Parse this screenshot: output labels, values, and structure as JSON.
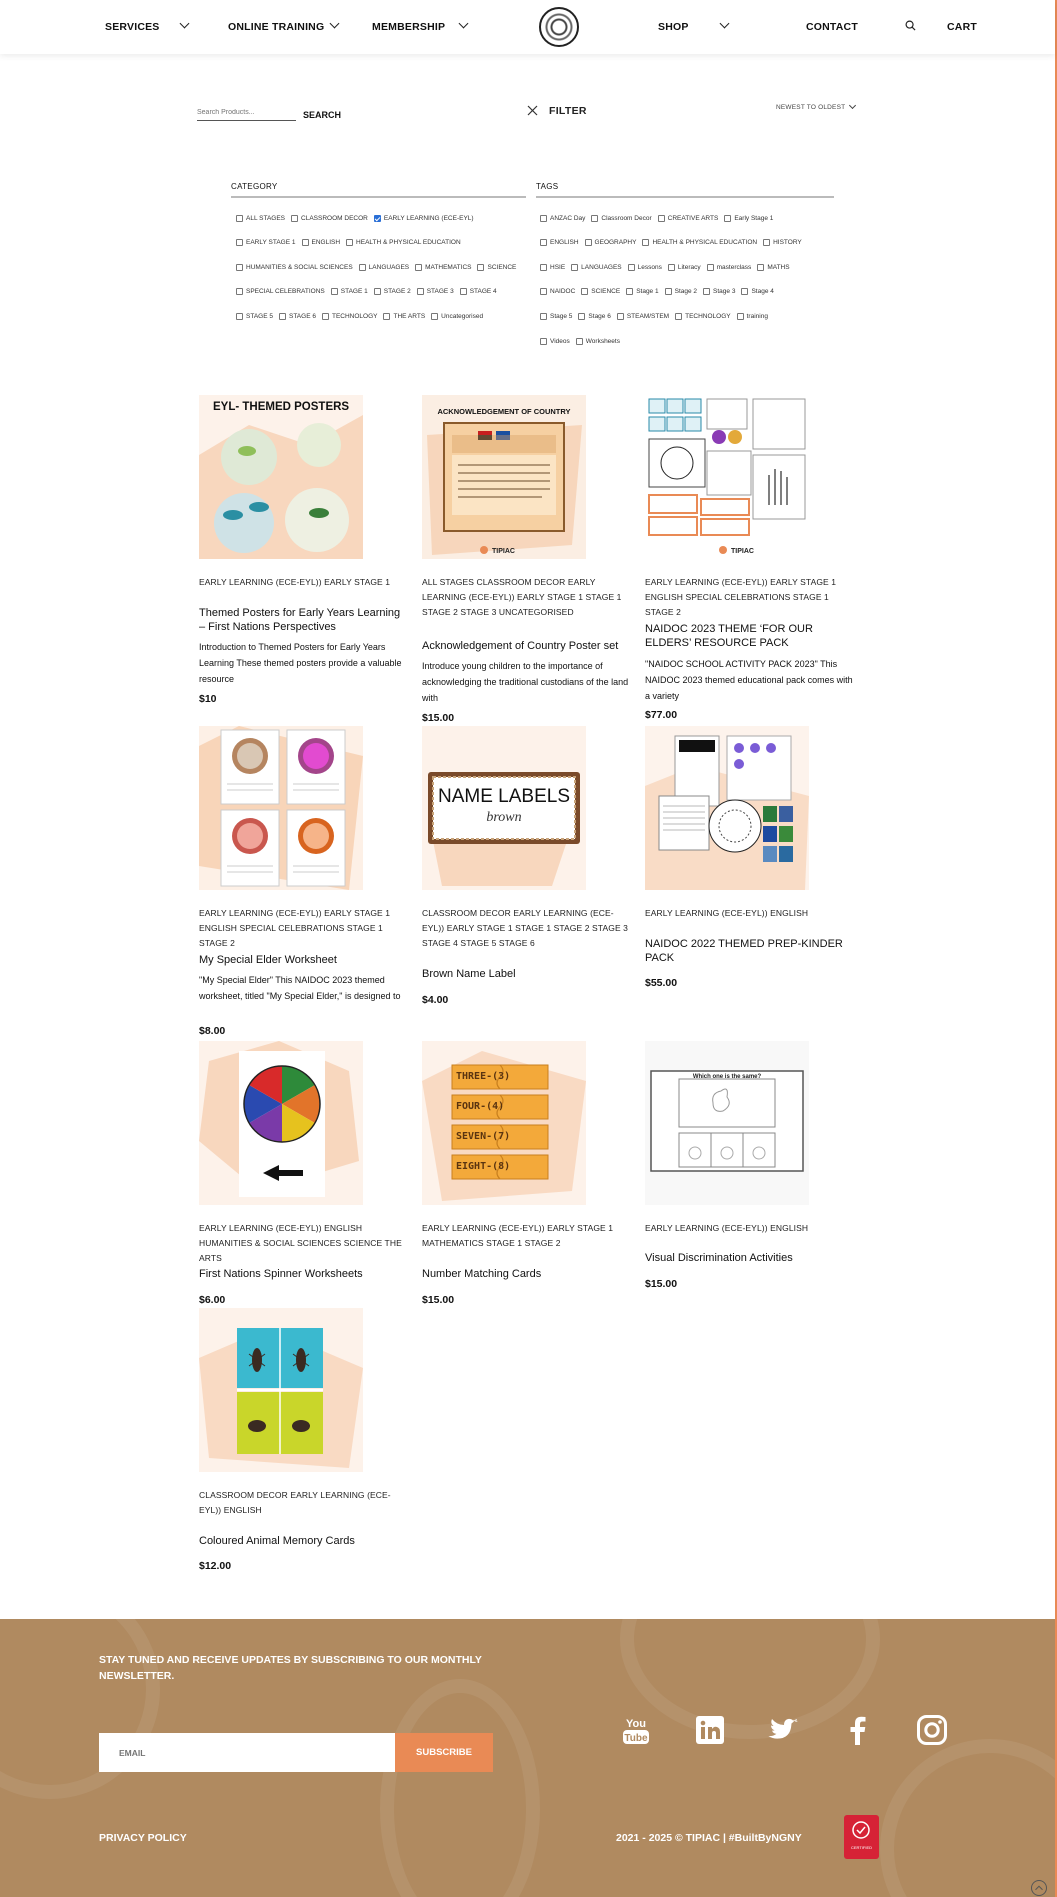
{
  "nav": {
    "services": "SERVICES",
    "online_training": "ONLINE TRAINING",
    "membership": "MEMBERSHIP",
    "shop": "SHOP",
    "contact": "CONTACT",
    "cart": "CART"
  },
  "toolbar": {
    "search_placeholder": "Search Products...",
    "search_label": "SEARCH",
    "filter_label": "FILTER",
    "sort_label": "NEWEST TO OLDEST"
  },
  "filters": {
    "category_heading": "CATEGORY",
    "tags_heading": "TAGS",
    "category_rows": [
      [
        {
          "label": "ALL STAGES",
          "checked": false
        },
        {
          "label": "CLASSROOM DECOR",
          "checked": false
        },
        {
          "label": "EARLY LEARNING (ECE-EYL)",
          "checked": true
        }
      ],
      [
        {
          "label": "EARLY STAGE 1",
          "checked": false
        },
        {
          "label": "ENGLISH",
          "checked": false
        },
        {
          "label": "HEALTH & PHYSICAL EDUCATION",
          "checked": false
        }
      ],
      [
        {
          "label": "HUMANITIES & SOCIAL SCIENCES",
          "checked": false
        },
        {
          "label": "LANGUAGES",
          "checked": false
        },
        {
          "label": "MATHEMATICS",
          "checked": false
        },
        {
          "label": "SCIENCE",
          "checked": false
        }
      ],
      [
        {
          "label": "SPECIAL CELEBRATIONS",
          "checked": false
        },
        {
          "label": "STAGE 1",
          "checked": false
        },
        {
          "label": "STAGE 2",
          "checked": false
        },
        {
          "label": "STAGE 3",
          "checked": false
        },
        {
          "label": "STAGE 4",
          "checked": false
        }
      ],
      [
        {
          "label": "STAGE 5",
          "checked": false
        },
        {
          "label": "STAGE 6",
          "checked": false
        },
        {
          "label": "TECHNOLOGY",
          "checked": false
        },
        {
          "label": "THE ARTS",
          "checked": false
        },
        {
          "label": "Uncategorised",
          "checked": false
        }
      ]
    ],
    "tag_rows": [
      [
        {
          "label": "ANZAC Day",
          "checked": false
        },
        {
          "label": "Classroom Decor",
          "checked": false
        },
        {
          "label": "CREATIVE ARTS",
          "checked": false
        },
        {
          "label": "Early Stage 1",
          "checked": false
        }
      ],
      [
        {
          "label": "ENGLISH",
          "checked": false
        },
        {
          "label": "GEOGRAPHY",
          "checked": false
        },
        {
          "label": "HEALTH & PHYSICAL EDUCATION",
          "checked": false
        },
        {
          "label": "HISTORY",
          "checked": false
        }
      ],
      [
        {
          "label": "HSIE",
          "checked": false
        },
        {
          "label": "LANGUAGES",
          "checked": false
        },
        {
          "label": "Lessons",
          "checked": false
        },
        {
          "label": "Literacy",
          "checked": false
        },
        {
          "label": "masterclass",
          "checked": false
        },
        {
          "label": "MATHS",
          "checked": false
        }
      ],
      [
        {
          "label": "NAIDOC",
          "checked": false
        },
        {
          "label": "SCIENCE",
          "checked": false
        },
        {
          "label": "Stage 1",
          "checked": false
        },
        {
          "label": "Stage 2",
          "checked": false
        },
        {
          "label": "Stage 3",
          "checked": false
        },
        {
          "label": "Stage 4",
          "checked": false
        }
      ],
      [
        {
          "label": "Stage 5",
          "checked": false
        },
        {
          "label": "Stage 6",
          "checked": false
        },
        {
          "label": "STEAM/STEM",
          "checked": false
        },
        {
          "label": "TECHNOLOGY",
          "checked": false
        },
        {
          "label": "training",
          "checked": false
        }
      ],
      [
        {
          "label": "Videos",
          "checked": false
        },
        {
          "label": "Worksheets",
          "checked": false
        }
      ]
    ]
  },
  "products": [
    {
      "cats": "EARLY LEARNING (ECE-EYL)) EARLY STAGE 1",
      "title": "Themed Posters for Early Years Learning – First Nations Perspectives",
      "desc": "Introduction to Themed Posters for Early Years Learning These themed posters provide a valuable resource",
      "price": "$10",
      "thumb_heading": "EYL- THEMED POSTERS"
    },
    {
      "cats": "ALL STAGES CLASSROOM DECOR EARLY LEARNING (ECE-EYL)) EARLY STAGE 1 STAGE 1 STAGE 2 STAGE 3 UNCATEGORISED",
      "title": "Acknowledgement of Country Poster set",
      "desc": "Introduce young children to the importance of acknowledging the traditional custodians of the land with",
      "price": "$15.00",
      "thumb_heading": "ACKNOWLEDGEMENT OF COUNTRY"
    },
    {
      "cats": "EARLY LEARNING (ECE-EYL)) EARLY STAGE 1 ENGLISH SPECIAL CELEBRATIONS STAGE 1 STAGE 2",
      "title": "NAIDOC 2023 THEME ‘FOR OUR ELDERS’ RESOURCE PACK",
      "desc": "\"NAIDOC SCHOOL ACTIVITY PACK 2023\" This NAIDOC 2023 themed educational pack comes with a variety",
      "price": "$77.00",
      "thumb_heading": ""
    },
    {
      "cats": "EARLY LEARNING (ECE-EYL)) EARLY STAGE 1 ENGLISH SPECIAL CELEBRATIONS STAGE 1 STAGE 2",
      "title": "My Special Elder Worksheet",
      "desc": "\"My Special Elder\" This NAIDOC 2023 themed worksheet, titled \"My Special Elder,\" is designed to",
      "price": "$8.00",
      "thumb_heading": ""
    },
    {
      "cats": "CLASSROOM DECOR EARLY LEARNING (ECE-EYL)) EARLY STAGE 1 STAGE 1 STAGE 2 STAGE 3 STAGE 4 STAGE 5 STAGE 6",
      "title": "Brown Name Label",
      "desc": "",
      "price": "$4.00",
      "thumb_heading": "NAME LABELS",
      "thumb_sub": "brown"
    },
    {
      "cats": "EARLY LEARNING (ECE-EYL)) ENGLISH",
      "title": "NAIDOC 2022 THEMED PREP-KINDER PACK",
      "desc": "",
      "price": "$55.00",
      "thumb_heading": ""
    },
    {
      "cats": "EARLY LEARNING (ECE-EYL)) ENGLISH HUMANITIES & SOCIAL SCIENCES SCIENCE THE ARTS",
      "title": "First Nations Spinner Worksheets",
      "desc": "",
      "price": "$6.00",
      "thumb_heading": ""
    },
    {
      "cats": "EARLY LEARNING (ECE-EYL)) EARLY STAGE 1 MATHEMATICS STAGE 1 STAGE 2",
      "title": "Number Matching Cards",
      "desc": "",
      "price": "$15.00",
      "thumb_heading": "",
      "thumb_cards": [
        "THREE-(3)",
        "FOUR-(4)",
        "SEVEN-(7)",
        "EIGHT-(8)"
      ]
    },
    {
      "cats": "EARLY LEARNING (ECE-EYL)) ENGLISH",
      "title": "Visual Discrimination Activities",
      "desc": "",
      "price": "$15.00",
      "thumb_heading": "Which one is the same?"
    },
    {
      "cats": "CLASSROOM DECOR EARLY LEARNING (ECE-EYL)) ENGLISH",
      "title": "Coloured Animal Memory Cards",
      "desc": "",
      "price": "$12.00",
      "thumb_heading": ""
    }
  ],
  "footer": {
    "newsletter": "STAY TUNED AND RECEIVE UPDATES BY SUBSCRIBING TO OUR MONTHLY NEWSLETTER.",
    "email_placeholder": "EMAIL",
    "subscribe_label": "SUBSCRIBE",
    "privacy": "PRIVACY POLICY",
    "copyright": "2021 - 2025 © TIPIAC | #BuiltByNGNY",
    "social_icons": [
      "youtube-icon",
      "linkedin-icon",
      "twitter-icon",
      "facebook-icon",
      "instagram-icon"
    ],
    "badge_text": "CERTIFIED"
  },
  "colors": {
    "accent": "#e98a55",
    "footer_bg": "#b08a60",
    "checkbox_checked": "#2a6fd6"
  }
}
